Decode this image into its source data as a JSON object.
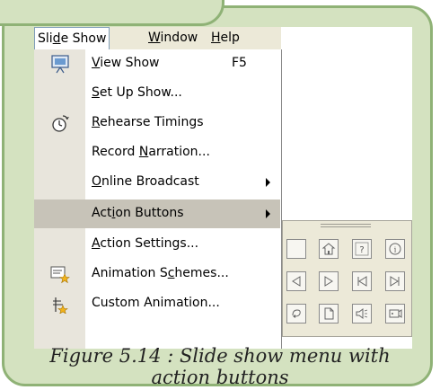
{
  "menubar": {
    "items": [
      {
        "label": "Slide Show"
      },
      {
        "label": "Window"
      },
      {
        "label": "Help"
      }
    ]
  },
  "menu": {
    "items": [
      {
        "label": "View Show",
        "shortcut": "F5",
        "icon": "view-show-icon"
      },
      {
        "label": "Set Up Show..."
      },
      {
        "label": "Rehearse Timings",
        "icon": "rehearse-timings-icon"
      },
      {
        "label": "Record Narration..."
      },
      {
        "label": "Online Broadcast",
        "submenu": true
      },
      {
        "label": "Action Buttons",
        "submenu": true,
        "highlighted": true
      },
      {
        "label": "Action Settings..."
      },
      {
        "label": "Animation Schemes...",
        "icon": "animation-schemes-icon"
      },
      {
        "label": "Custom Animation...",
        "icon": "custom-animation-icon"
      }
    ]
  },
  "palette": {
    "buttons": [
      "custom-button-icon",
      "home-button-icon",
      "help-button-icon",
      "information-button-icon",
      "back-button-icon",
      "forward-button-icon",
      "beginning-button-icon",
      "end-button-icon",
      "return-button-icon",
      "document-button-icon",
      "sound-button-icon",
      "movie-button-icon"
    ]
  },
  "caption": {
    "line1": "Figure 5.14 : Slide show menu with",
    "line2": "action buttons"
  },
  "colors": {
    "frame_fill": "#d4e2c0",
    "frame_border": "#8fb276",
    "menu_bar": "#ece9d8",
    "gutter": "#e8e5dc",
    "highlight": "#c7c3b8"
  }
}
